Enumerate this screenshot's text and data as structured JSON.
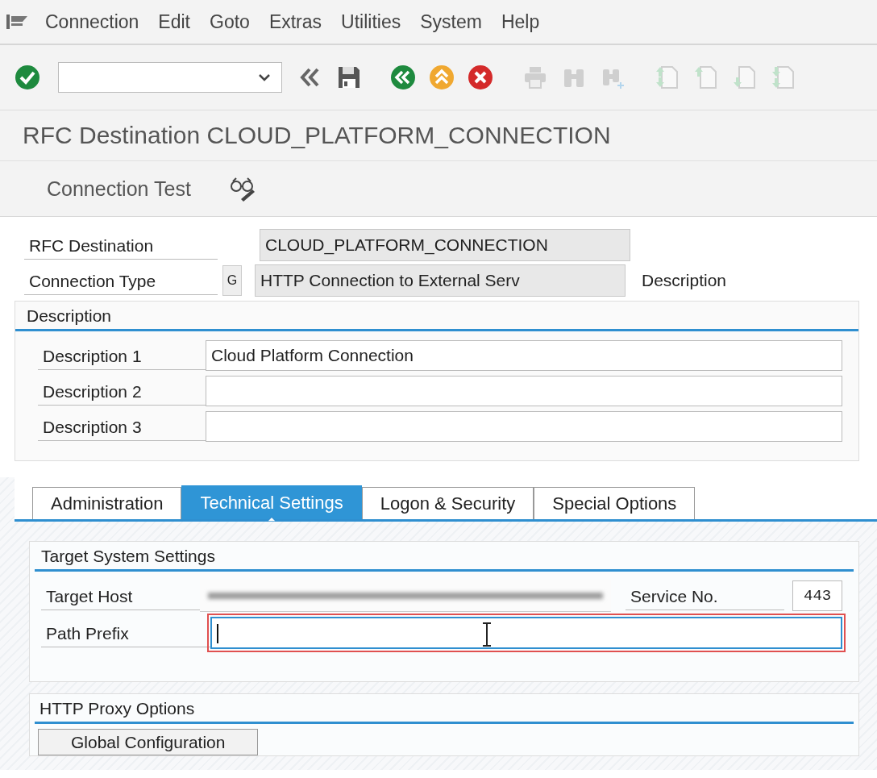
{
  "menu": [
    {
      "label": "Connection"
    },
    {
      "label": "Edit"
    },
    {
      "label": "Goto"
    },
    {
      "label": "Extras"
    },
    {
      "label": "Utilities"
    },
    {
      "label": "System"
    },
    {
      "label": "Help"
    }
  ],
  "toolbar": [
    {
      "kind": "enter",
      "disabled": false
    },
    {
      "kind": "command-field",
      "disabled": false
    },
    {
      "kind": "chevrons",
      "disabled": false
    },
    {
      "kind": "save",
      "disabled": false
    },
    {
      "kind": "back",
      "disabled": false
    },
    {
      "kind": "exit",
      "disabled": false
    },
    {
      "kind": "cancel",
      "disabled": false
    },
    {
      "kind": "print",
      "disabled": true
    },
    {
      "kind": "find",
      "disabled": true
    },
    {
      "kind": "find-next",
      "disabled": true
    },
    {
      "kind": "first-page",
      "disabled": true
    },
    {
      "kind": "prev-page",
      "disabled": true
    },
    {
      "kind": "next-page",
      "disabled": true
    },
    {
      "kind": "last-page",
      "disabled": true
    }
  ],
  "title": "RFC Destination CLOUD_PLATFORM_CONNECTION",
  "app_toolbar": {
    "button": "Connection Test"
  },
  "header": {
    "rfc_destination": {
      "label": "RFC Destination",
      "value": "CLOUD_PLATFORM_CONNECTION"
    },
    "connection_type": {
      "label": "Connection Type",
      "code": "G",
      "value": "HTTP Connection to External Serv",
      "description_label": "Description"
    }
  },
  "description_group": {
    "title": "Description",
    "rows": [
      {
        "label": "Description 1",
        "value": "Cloud Platform Connection"
      },
      {
        "label": "Description 2"
      },
      {
        "label": "Description 3"
      }
    ]
  },
  "tabs": [
    {
      "label": "Administration",
      "selected": false
    },
    {
      "label": "Technical Settings",
      "selected": true
    },
    {
      "label": "Logon & Security",
      "selected": false
    },
    {
      "label": "Special Options",
      "selected": false
    }
  ],
  "target_system": {
    "title": "Target System Settings",
    "target_host": {
      "label": "Target Host"
    },
    "service_no": {
      "label": "Service No.",
      "value": "443"
    },
    "path_prefix": {
      "label": "Path Prefix",
      "focused": true
    }
  },
  "proxy": {
    "title": "HTTP Proxy Options",
    "button": "Global Configuration"
  }
}
